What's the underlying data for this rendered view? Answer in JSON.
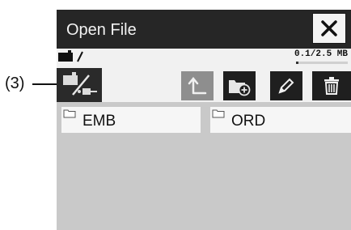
{
  "callout": {
    "label": "(3)"
  },
  "dialog": {
    "title": "Open File"
  },
  "storage": {
    "memory_text": "0.1/2.5 MB",
    "memory_used_fraction": 0.04
  },
  "toolbar": {
    "icons": [
      "usb-media-icon",
      "up-arrow-icon",
      "new-folder-icon",
      "pencil-icon",
      "trash-icon"
    ]
  },
  "files": [
    {
      "name": "EMB",
      "icon": "folder-icon"
    },
    {
      "name": "ORD",
      "icon": "folder-icon"
    }
  ],
  "colors": {
    "titlebar": "#262626",
    "toolbar_button": "#1f1f1f",
    "disabled_button": "#8e8e8e",
    "panel": "#c9c9c9"
  }
}
